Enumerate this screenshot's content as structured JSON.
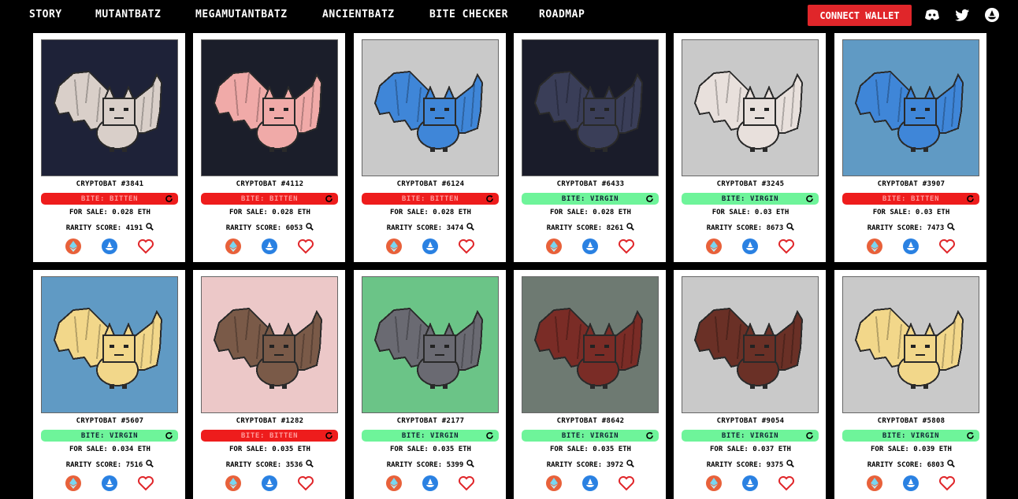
{
  "nav": {
    "links": [
      "STORY",
      "MUTANTBATZ",
      "MEGAMUTANTBATZ",
      "ANCIENTBATZ",
      "BITE CHECKER",
      "ROADMAP"
    ],
    "connect_label": "CONNECT WALLET",
    "icons": [
      "discord-icon",
      "twitter-icon",
      "opensea-icon"
    ]
  },
  "labels": {
    "for_sale_prefix": "FOR SALE:",
    "rarity_prefix": "RARITY SCORE:",
    "bite_prefix": "BITE:"
  },
  "colors": {
    "bitten": "#ee1c1c",
    "virgin": "#6ef49a",
    "connect": "#e0262a"
  },
  "cards": [
    {
      "name": "CRYPTOBAT #3841",
      "bite": "BITTEN",
      "price": "0.028 ETH",
      "rarity": "4191",
      "bg": "#1e2238",
      "bat": "#d9cfc9"
    },
    {
      "name": "CRYPTOBAT #4112",
      "bite": "BITTEN",
      "price": "0.028 ETH",
      "rarity": "6053",
      "bg": "#1b1e2a",
      "bat": "#f0aaa8"
    },
    {
      "name": "CRYPTOBAT #6124",
      "bite": "BITTEN",
      "price": "0.028 ETH",
      "rarity": "3474",
      "bg": "#c9c9c9",
      "bat": "#3f86d8"
    },
    {
      "name": "CRYPTOBAT #6433",
      "bite": "VIRGIN",
      "price": "0.028 ETH",
      "rarity": "8261",
      "bg": "#1a1c2a",
      "bat": "#3a3e58"
    },
    {
      "name": "CRYPTOBAT #3245",
      "bite": "VIRGIN",
      "price": "0.03 ETH",
      "rarity": "8673",
      "bg": "#c9c9c9",
      "bat": "#e8e0dc"
    },
    {
      "name": "CRYPTOBAT #3907",
      "bite": "BITTEN",
      "price": "0.03 ETH",
      "rarity": "7473",
      "bg": "#609ac4",
      "bat": "#3f86d8"
    },
    {
      "name": "CRYPTOBAT #5607",
      "bite": "VIRGIN",
      "price": "0.034 ETH",
      "rarity": "7516",
      "bg": "#609ac4",
      "bat": "#f2d78a"
    },
    {
      "name": "CRYPTOBAT #1282",
      "bite": "BITTEN",
      "price": "0.035 ETH",
      "rarity": "3536",
      "bg": "#ecc8c8",
      "bat": "#7a5a48"
    },
    {
      "name": "CRYPTOBAT #2177",
      "bite": "VIRGIN",
      "price": "0.035 ETH",
      "rarity": "5399",
      "bg": "#6bc487",
      "bat": "#6a6a72"
    },
    {
      "name": "CRYPTOBAT #8642",
      "bite": "VIRGIN",
      "price": "0.035 ETH",
      "rarity": "3972",
      "bg": "#6e7a72",
      "bat": "#7a2c26"
    },
    {
      "name": "CRYPTOBAT #9054",
      "bite": "VIRGIN",
      "price": "0.037 ETH",
      "rarity": "9375",
      "bg": "#c9c9c9",
      "bat": "#6a3026"
    },
    {
      "name": "CRYPTOBAT #5808",
      "bite": "VIRGIN",
      "price": "0.039 ETH",
      "rarity": "6803",
      "bg": "#c9c9c9",
      "bat": "#f2d78a"
    }
  ]
}
